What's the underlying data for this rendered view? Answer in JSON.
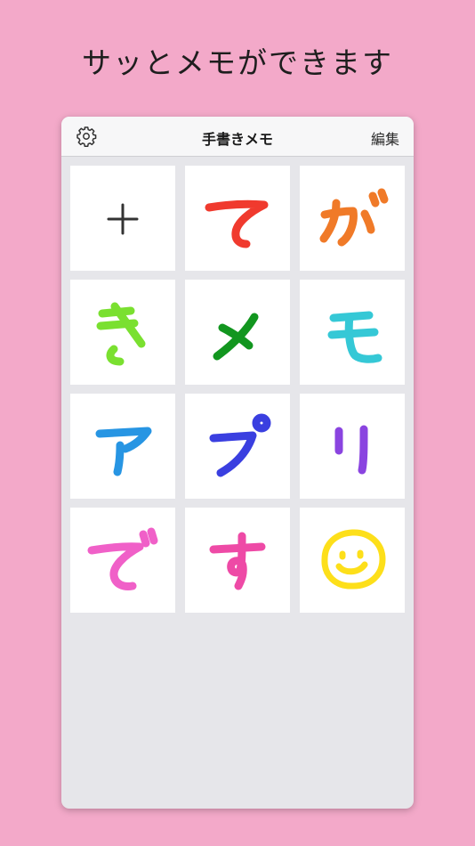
{
  "headline": "サッとメモができます",
  "navbar": {
    "title": "手書きメモ",
    "edit_label": "編集",
    "settings_icon": "gear-icon"
  },
  "tiles": [
    {
      "kind": "add",
      "char": "+",
      "color": "#333333"
    },
    {
      "kind": "memo",
      "char": "て",
      "color": "#f03a2e"
    },
    {
      "kind": "memo",
      "char": "が",
      "color": "#f07a28"
    },
    {
      "kind": "memo",
      "char": "き",
      "color": "#7ae030"
    },
    {
      "kind": "memo",
      "char": "メ",
      "color": "#12961f"
    },
    {
      "kind": "memo",
      "char": "モ",
      "color": "#35c8d6"
    },
    {
      "kind": "memo",
      "char": "ア",
      "color": "#2795e3"
    },
    {
      "kind": "memo",
      "char": "プ",
      "color": "#3a3fe0"
    },
    {
      "kind": "memo",
      "char": "リ",
      "color": "#8a44e0"
    },
    {
      "kind": "memo",
      "char": "で",
      "color": "#f060c8"
    },
    {
      "kind": "memo",
      "char": "す",
      "color": "#ee4aa6"
    },
    {
      "kind": "memo",
      "char": "☺",
      "color": "#fddf1a"
    }
  ]
}
